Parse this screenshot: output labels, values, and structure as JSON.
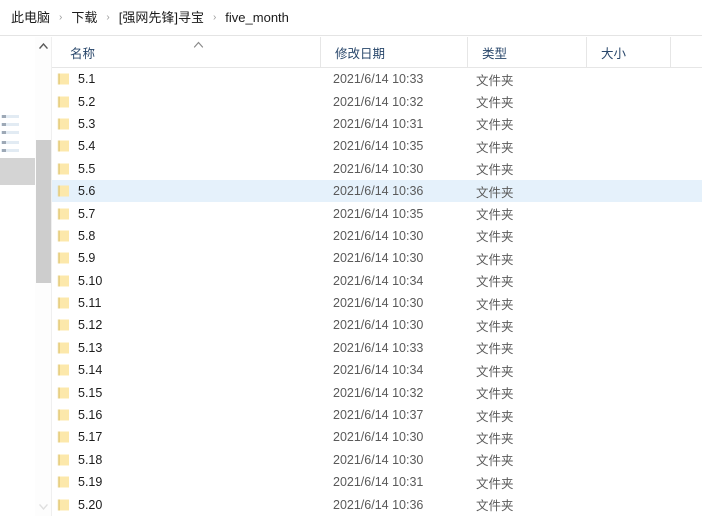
{
  "address_bar": {
    "separator": "›",
    "breadcrumbs": [
      {
        "label": "此电脑"
      },
      {
        "label": "下载"
      },
      {
        "label": "[强网先锋]寻宝"
      },
      {
        "label": "five_month"
      }
    ]
  },
  "scrollbar": {
    "up_arrow_icon": "chevron-up-icon",
    "down_arrow_icon": "chevron-down-icon"
  },
  "columns": {
    "sort_indicator_icon": "sort-ascending-chevron-icon",
    "headers": [
      {
        "key": "name",
        "label": "名称"
      },
      {
        "key": "date",
        "label": "修改日期"
      },
      {
        "key": "type",
        "label": "类型"
      },
      {
        "key": "size",
        "label": "大小"
      }
    ]
  },
  "theme": {
    "selection_background": "#e5f1fb",
    "folder_icon_fill": "#fce8ab",
    "folder_icon_edge": "#e3c873",
    "header_text": "#29476b",
    "secondary_text": "#5a5a5a"
  },
  "file_list": {
    "icon": "folder-icon",
    "rows": [
      {
        "name": "5.1",
        "date": "2021/6/14 10:33",
        "type": "文件夹",
        "size": "",
        "selected": false
      },
      {
        "name": "5.2",
        "date": "2021/6/14 10:32",
        "type": "文件夹",
        "size": "",
        "selected": false
      },
      {
        "name": "5.3",
        "date": "2021/6/14 10:31",
        "type": "文件夹",
        "size": "",
        "selected": false
      },
      {
        "name": "5.4",
        "date": "2021/6/14 10:35",
        "type": "文件夹",
        "size": "",
        "selected": false
      },
      {
        "name": "5.5",
        "date": "2021/6/14 10:30",
        "type": "文件夹",
        "size": "",
        "selected": false
      },
      {
        "name": "5.6",
        "date": "2021/6/14 10:36",
        "type": "文件夹",
        "size": "",
        "selected": true
      },
      {
        "name": "5.7",
        "date": "2021/6/14 10:35",
        "type": "文件夹",
        "size": "",
        "selected": false
      },
      {
        "name": "5.8",
        "date": "2021/6/14 10:30",
        "type": "文件夹",
        "size": "",
        "selected": false
      },
      {
        "name": "5.9",
        "date": "2021/6/14 10:30",
        "type": "文件夹",
        "size": "",
        "selected": false
      },
      {
        "name": "5.10",
        "date": "2021/6/14 10:34",
        "type": "文件夹",
        "size": "",
        "selected": false
      },
      {
        "name": "5.11",
        "date": "2021/6/14 10:30",
        "type": "文件夹",
        "size": "",
        "selected": false
      },
      {
        "name": "5.12",
        "date": "2021/6/14 10:30",
        "type": "文件夹",
        "size": "",
        "selected": false
      },
      {
        "name": "5.13",
        "date": "2021/6/14 10:33",
        "type": "文件夹",
        "size": "",
        "selected": false
      },
      {
        "name": "5.14",
        "date": "2021/6/14 10:34",
        "type": "文件夹",
        "size": "",
        "selected": false
      },
      {
        "name": "5.15",
        "date": "2021/6/14 10:32",
        "type": "文件夹",
        "size": "",
        "selected": false
      },
      {
        "name": "5.16",
        "date": "2021/6/14 10:37",
        "type": "文件夹",
        "size": "",
        "selected": false
      },
      {
        "name": "5.17",
        "date": "2021/6/14 10:30",
        "type": "文件夹",
        "size": "",
        "selected": false
      },
      {
        "name": "5.18",
        "date": "2021/6/14 10:30",
        "type": "文件夹",
        "size": "",
        "selected": false
      },
      {
        "name": "5.19",
        "date": "2021/6/14 10:31",
        "type": "文件夹",
        "size": "",
        "selected": false
      },
      {
        "name": "5.20",
        "date": "2021/6/14 10:36",
        "type": "文件夹",
        "size": "",
        "selected": false
      }
    ]
  }
}
